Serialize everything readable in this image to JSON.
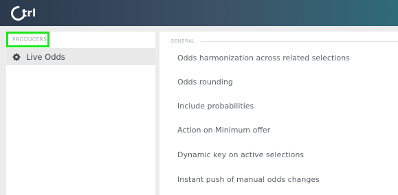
{
  "header": {
    "logo_text": "trl",
    "logo_letter": "C",
    "background_colors": [
      "#2b3a4d",
      "#3d5266",
      "#2f6a78"
    ]
  },
  "sidebar": {
    "section_label": "PRODUCERS",
    "highlight_color": "#19e619",
    "items": [
      {
        "label": "Live Odds",
        "icon": "gear-icon"
      }
    ]
  },
  "main": {
    "section_label": "GENERAL",
    "settings": [
      {
        "label": "Odds harmonization across related selections"
      },
      {
        "label": "Odds rounding"
      },
      {
        "label": "Include probabilities"
      },
      {
        "label": "Action on Minimum offer"
      },
      {
        "label": "Dynamic key on active selections"
      },
      {
        "label": "Instant push of manual odds changes"
      }
    ]
  }
}
